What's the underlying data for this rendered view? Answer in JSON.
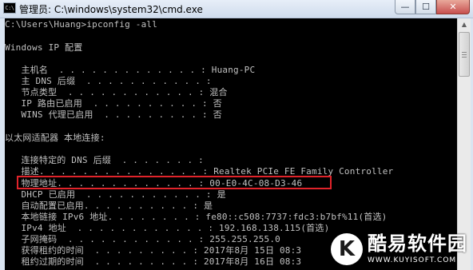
{
  "window": {
    "icon_text": "C:\\",
    "title": "管理员: C:\\windows\\system32\\cmd.exe",
    "controls": {
      "minimize": "—",
      "maximize": "☐",
      "close": "✕"
    }
  },
  "console": {
    "lines": [
      "C:\\Users\\Huang>ipconfig -all",
      "",
      "Windows IP 配置",
      "",
      "   主机名  . . . . . . . . . . . . . : Huang-PC",
      "   主 DNS 后缀  . . . . . . . . . . . :",
      "   节点类型  . . . . . . . . . . . . : 混合",
      "   IP 路由已启用  . . . . . . . . . . : 否",
      "   WINS 代理已启用  . . . . . . . . . : 否",
      "",
      "以太网适配器 本地连接:",
      "",
      "   连接特定的 DNS 后缀  . . . . . . . :",
      "   描述. . . . . . . . . . . . . . . : Realtek PCIe FE Family Controller",
      "   物理地址. . . . . . . . . . . . . : 00-E0-4C-08-D3-46",
      "   DHCP 已启用  . . . . . . . . . . . : 是",
      "   自动配置已启用. . . . . . . . . . : 是",
      "   本地链接 IPv6 地址. . . . . . . . : fe80::c508:7737:fdc3:b7bf%11(首选)",
      "   IPv4 地址  . . . . . . . . . . . . : 192.168.138.115(首选)",
      "   子网掩码  . . . . . . . . . . . . : 255.255.255.0",
      "   获得租约的时间  . . . . . . . . . : 2017年8月 15日 08:3",
      "   租约过期的时间  . . . . . . . . . : 2017年8月 16日 08:3"
    ]
  },
  "scrollbar": {
    "up_arrow": "▲"
  },
  "watermark": {
    "logo_letter": "K",
    "site_name": "酷易软件园",
    "url": "WWW.KUYISOFT.COM"
  },
  "colors": {
    "console_background": "#000000",
    "console_text": "#c0c0c0",
    "highlight_border": "#e0232a",
    "close_button": "#c75050"
  }
}
